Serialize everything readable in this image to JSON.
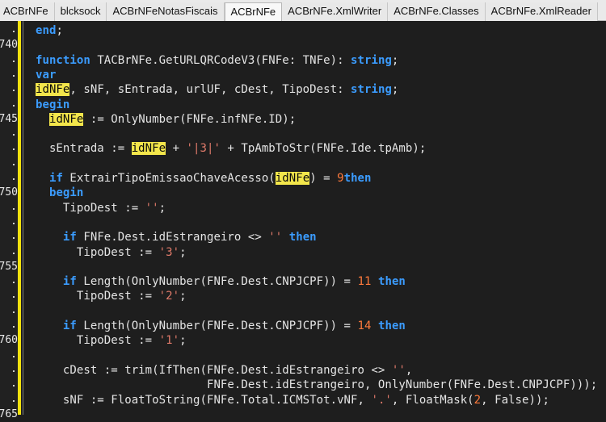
{
  "tabs": [
    "ACBrNFe",
    "blcksock",
    "ACBrNFeNotasFiscais",
    "ACBrNFe",
    "ACBrNFe.XmlWriter",
    "ACBrNFe.Classes",
    "ACBrNFe.XmlReader"
  ],
  "active_tab_index": 3,
  "line_numbers": [
    "740",
    "745",
    "750",
    "755",
    "760",
    "765"
  ],
  "code": [
    [
      [
        "kw",
        "end"
      ],
      [
        "",
        "; "
      ]
    ],
    [],
    [
      [
        "kw",
        "function"
      ],
      [
        "",
        " TACBrNFe.GetURLQRCodeV3(FNFe: TNFe): "
      ],
      [
        "kw",
        "string"
      ],
      [
        "",
        ";"
      ]
    ],
    [
      [
        "kw",
        "var"
      ]
    ],
    [
      [
        "",
        ""
      ],
      [
        "hl",
        "idNFe"
      ],
      [
        "",
        ", sNF, sEntrada, urlUF, cDest, TipoDest: "
      ],
      [
        "kw",
        "string"
      ],
      [
        "",
        ";"
      ]
    ],
    [
      [
        "kw",
        "begin"
      ]
    ],
    [
      [
        "",
        "  "
      ],
      [
        "hl",
        "idNFe"
      ],
      [
        "",
        " := OnlyNumber(FNFe.infNFe.ID);"
      ]
    ],
    [],
    [
      [
        "",
        "  sEntrada := "
      ],
      [
        "hl",
        "idNFe"
      ],
      [
        "",
        " + "
      ],
      [
        "str",
        "'|3|'"
      ],
      [
        "",
        " + TpAmbToStr(FNFe.Ide.tpAmb);"
      ]
    ],
    [],
    [
      [
        "",
        "  "
      ],
      [
        "kw",
        "if"
      ],
      [
        "",
        " ExtrairTipoEmissaoChaveAcesso("
      ],
      [
        "hl",
        "idNFe"
      ],
      [
        "",
        ") = "
      ],
      [
        "num",
        "9"
      ],
      [
        "",
        "",
        " "
      ],
      [
        "kw",
        "then"
      ]
    ],
    [
      [
        "",
        "  "
      ],
      [
        "kw",
        "begin"
      ]
    ],
    [
      [
        "",
        "    TipoDest := "
      ],
      [
        "str",
        "''"
      ],
      [
        "",
        ";"
      ]
    ],
    [],
    [
      [
        "",
        "    "
      ],
      [
        "kw",
        "if"
      ],
      [
        "",
        " FNFe.Dest.idEstrangeiro <> "
      ],
      [
        "str",
        "''"
      ],
      [
        "",
        " "
      ],
      [
        "kw",
        "then"
      ]
    ],
    [
      [
        "",
        "      TipoDest := "
      ],
      [
        "str",
        "'3'"
      ],
      [
        "",
        ";"
      ]
    ],
    [],
    [
      [
        "",
        "    "
      ],
      [
        "kw",
        "if"
      ],
      [
        "",
        " Length(OnlyNumber(FNFe.Dest.CNPJCPF)) = "
      ],
      [
        "num",
        "11"
      ],
      [
        "",
        " "
      ],
      [
        "kw",
        "then"
      ]
    ],
    [
      [
        "",
        "      TipoDest := "
      ],
      [
        "str",
        "'2'"
      ],
      [
        "",
        ";"
      ]
    ],
    [],
    [
      [
        "",
        "    "
      ],
      [
        "kw",
        "if"
      ],
      [
        "",
        " Length(OnlyNumber(FNFe.Dest.CNPJCPF)) = "
      ],
      [
        "num",
        "14"
      ],
      [
        "",
        " "
      ],
      [
        "kw",
        "then"
      ]
    ],
    [
      [
        "",
        "      TipoDest := "
      ],
      [
        "str",
        "'1'"
      ],
      [
        "",
        ";"
      ]
    ],
    [],
    [
      [
        "",
        "    cDest := trim(IfThen(FNFe.Dest.idEstrangeiro <> "
      ],
      [
        "str",
        "''"
      ],
      [
        "",
        ","
      ]
    ],
    [
      [
        "",
        "                         FNFe.Dest.idEstrangeiro, OnlyNumber(FNFe.Dest.CNPJCPF)));"
      ]
    ],
    [
      [
        "",
        "    sNF := FloatToString(FNFe.Total.ICMSTot.vNF, "
      ],
      [
        "str",
        "'.'"
      ],
      [
        "",
        ", FloatMask("
      ],
      [
        "num",
        "2"
      ],
      [
        "",
        ", False));"
      ]
    ],
    []
  ]
}
